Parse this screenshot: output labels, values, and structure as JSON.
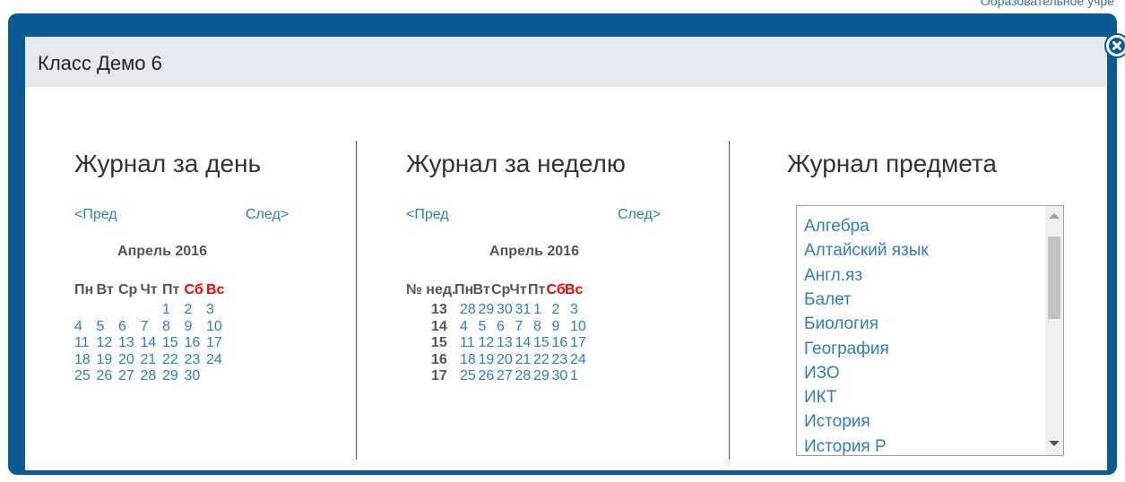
{
  "background": {
    "partial_text": "Образовательное учре"
  },
  "dialog": {
    "title": "Класс Демо 6",
    "close_icon": "close-circle-icon",
    "frame_color": "#0a5a95"
  },
  "day_journal": {
    "heading": "Журнал за день",
    "prev": "<Пред",
    "next": "След>",
    "month": "Апрель 2016",
    "weekdays": [
      "Пн",
      "Вт",
      "Ср",
      "Чт",
      "Пт",
      "Сб",
      "Вс"
    ],
    "weeks": [
      [
        "",
        "",
        "",
        "",
        "1",
        "2",
        "3"
      ],
      [
        "4",
        "5",
        "6",
        "7",
        "8",
        "9",
        "10"
      ],
      [
        "11",
        "12",
        "13",
        "14",
        "15",
        "16",
        "17"
      ],
      [
        "18",
        "19",
        "20",
        "21",
        "22",
        "23",
        "24"
      ],
      [
        "25",
        "26",
        "27",
        "28",
        "29",
        "30",
        ""
      ]
    ]
  },
  "week_journal": {
    "heading": "Журнал за неделю",
    "prev": "<Пред",
    "next": "След>",
    "month": "Апрель 2016",
    "week_col": "№ нед.",
    "weekdays": [
      "Пн",
      "Вт",
      "Ср",
      "Чт",
      "Пт",
      "Сб",
      "Вс"
    ],
    "weeks": [
      {
        "num": "13",
        "days": [
          "28",
          "29",
          "30",
          "31",
          "1",
          "2",
          "3"
        ]
      },
      {
        "num": "14",
        "days": [
          "4",
          "5",
          "6",
          "7",
          "8",
          "9",
          "10"
        ]
      },
      {
        "num": "15",
        "days": [
          "11",
          "12",
          "13",
          "14",
          "15",
          "16",
          "17"
        ]
      },
      {
        "num": "16",
        "days": [
          "18",
          "19",
          "20",
          "21",
          "22",
          "23",
          "24"
        ]
      },
      {
        "num": "17",
        "days": [
          "25",
          "26",
          "27",
          "28",
          "29",
          "30",
          "1"
        ]
      }
    ]
  },
  "subject_journal": {
    "heading": "Журнал предмета",
    "subjects": [
      "Алгебра",
      "Алтайский язык",
      "Англ.яз",
      "Балет",
      "Биология",
      "География",
      "ИЗО",
      "ИКТ",
      "История",
      "История Р"
    ]
  },
  "colors": {
    "link": "#2e7fc1",
    "weekend": "#ff0000"
  }
}
